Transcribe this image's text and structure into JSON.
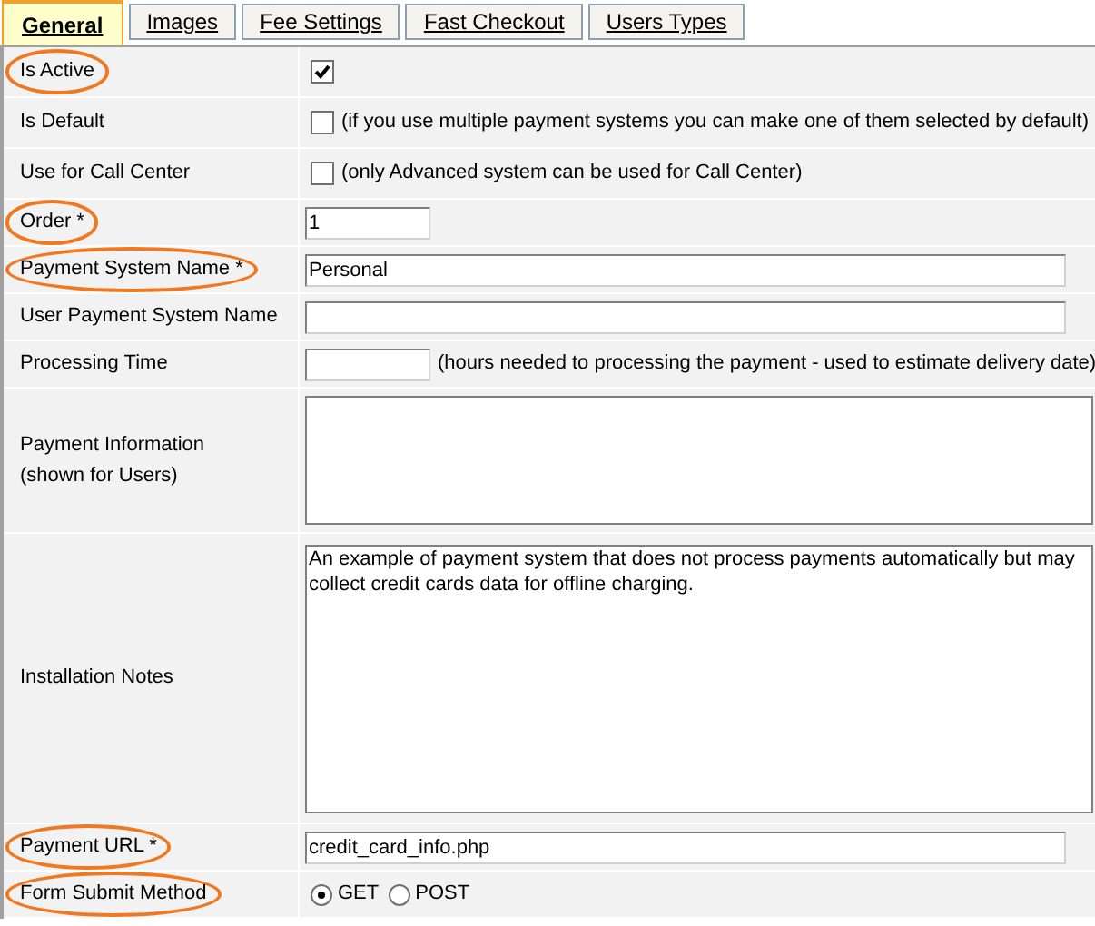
{
  "tabs": [
    {
      "label": "General",
      "selected": true
    },
    {
      "label": "Images",
      "selected": false
    },
    {
      "label": "Fee Settings",
      "selected": false
    },
    {
      "label": "Fast Checkout",
      "selected": false
    },
    {
      "label": "Users Types",
      "selected": false
    }
  ],
  "rows": [
    {
      "label": "Is Active",
      "highlighted": true,
      "kind": "checkbox",
      "checked": true
    },
    {
      "label": "Is Default",
      "highlighted": false,
      "kind": "checkbox",
      "checked": false,
      "note": "(if you use multiple payment systems you can make one of them selected by default)"
    },
    {
      "label": "Use for Call Center",
      "highlighted": false,
      "kind": "checkbox",
      "checked": false,
      "note": "(only Advanced system can be used for Call Center)"
    },
    {
      "label": "Order *",
      "highlighted": true,
      "kind": "short_input",
      "value": "1"
    },
    {
      "label": "Payment System Name *",
      "highlighted": true,
      "kind": "input",
      "value": "Personal"
    },
    {
      "label": "User Payment System Name",
      "highlighted": false,
      "kind": "input"
    },
    {
      "label": "Processing Time",
      "highlighted": false,
      "kind": "short_input",
      "note": "(hours needed to processing the payment - used to estimate delivery date)"
    },
    {
      "label": "Payment Information\n(shown for Users)",
      "highlighted": false,
      "kind": "textarea"
    },
    {
      "label": "Installation Notes",
      "highlighted": false,
      "kind": "textarea",
      "value": "An example of payment system that does not process payments automatically but may collect credit cards data for offline charging."
    },
    {
      "label": "Payment URL *",
      "highlighted": true,
      "kind": "input",
      "value": "credit_card_info.php"
    },
    {
      "label": "Form Submit Method",
      "highlighted": true,
      "kind": "radio",
      "options": [
        {
          "label": "GET",
          "selected": true
        },
        {
          "label": "POST",
          "selected": false
        }
      ]
    }
  ]
}
